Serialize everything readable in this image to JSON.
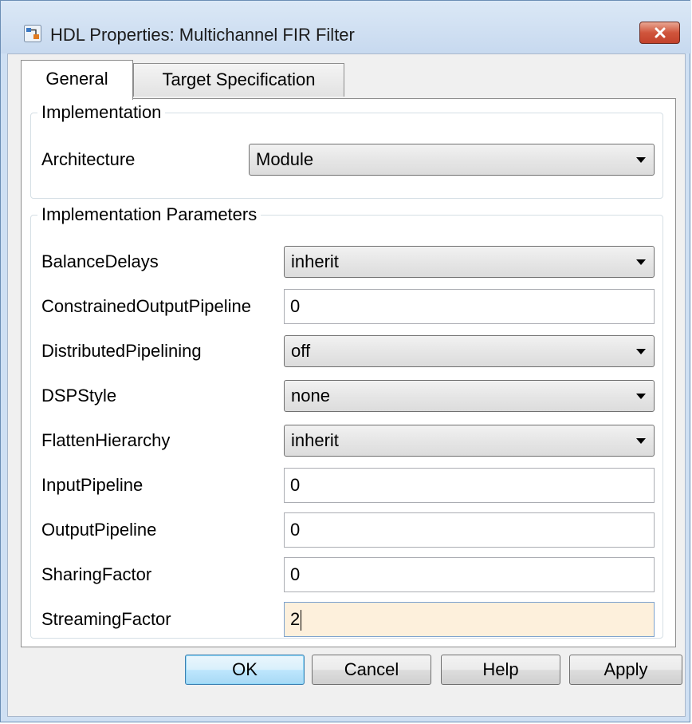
{
  "window": {
    "title": "HDL Properties: Multichannel FIR Filter",
    "close_icon": "close-icon"
  },
  "tabs": [
    {
      "label": "General",
      "selected": true
    },
    {
      "label": "Target Specification",
      "selected": false
    }
  ],
  "implementation": {
    "legend": "Implementation",
    "architecture_label": "Architecture",
    "architecture_value": "Module"
  },
  "parameters": {
    "legend": "Implementation Parameters",
    "balance_delays": {
      "label": "BalanceDelays",
      "value": "inherit"
    },
    "constrained_output_pipeline": {
      "label": "ConstrainedOutputPipeline",
      "value": "0"
    },
    "distributed_pipelining": {
      "label": "DistributedPipelining",
      "value": "off"
    },
    "dsp_style": {
      "label": "DSPStyle",
      "value": "none"
    },
    "flatten_hierarchy": {
      "label": "FlattenHierarchy",
      "value": "inherit"
    },
    "input_pipeline": {
      "label": "InputPipeline",
      "value": "0"
    },
    "output_pipeline": {
      "label": "OutputPipeline",
      "value": "0"
    },
    "sharing_factor": {
      "label": "SharingFactor",
      "value": "0"
    },
    "streaming_factor": {
      "label": "StreamingFactor",
      "value": "2"
    }
  },
  "buttons": {
    "ok": "OK",
    "cancel": "Cancel",
    "help": "Help",
    "apply": "Apply"
  },
  "colors": {
    "title_bar": "#c7d9ef",
    "close_button": "#c2412b",
    "active_field": "#fdf0dc"
  }
}
